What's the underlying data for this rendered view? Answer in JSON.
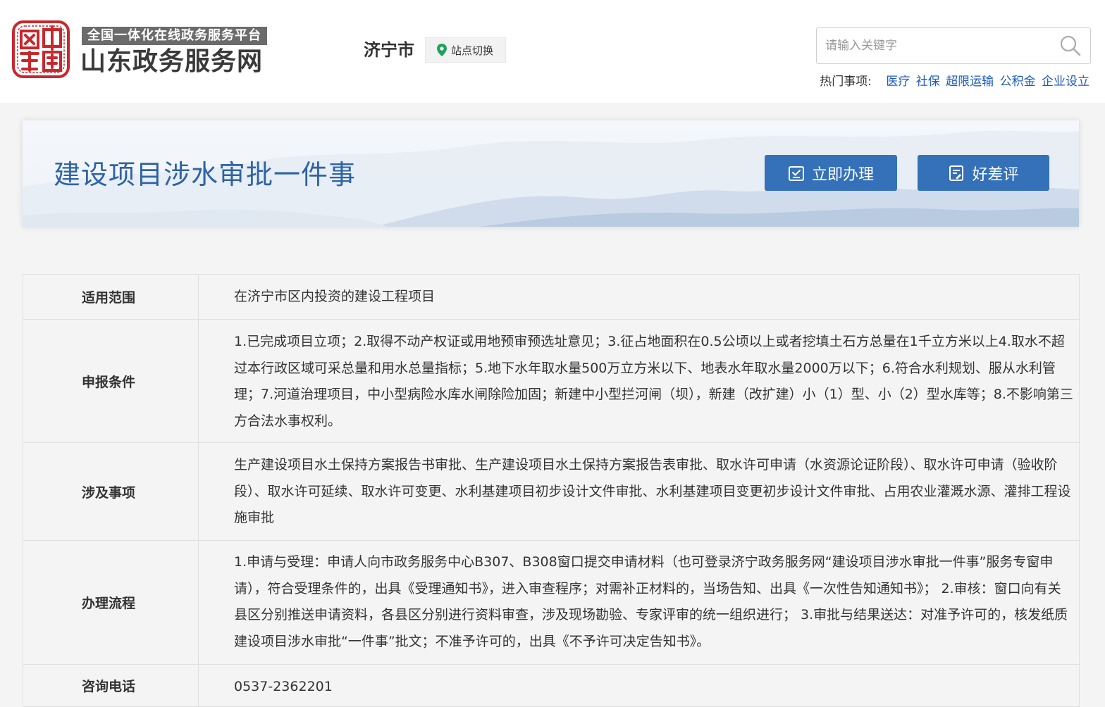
{
  "header": {
    "brand_subtitle": "全国一体化在线政务服务平台",
    "brand_title": "山东政务服务网",
    "city": "济宁市",
    "site_switch_label": "站点切换",
    "search_placeholder": "请输入关键字",
    "hot_label": "热门事项:",
    "hot_items": [
      "医疗",
      "社保",
      "超限运输",
      "公积金",
      "企业设立"
    ]
  },
  "banner": {
    "title": "建设项目涉水审批一件事",
    "apply_button": "立即办理",
    "review_button": "好差评"
  },
  "table": {
    "rows": [
      {
        "label": "适用范围",
        "value": "在济宁市区内投资的建设工程项目"
      },
      {
        "label": "申报条件",
        "value": "1.已完成项目立项；2.取得不动产权证或用地预审预选址意见；3.征占地面积在0.5公顷以上或者挖填土石方总量在1千立方米以上4.取水不超过本行政区域可采总量和用水总量指标；5.地下水年取水量500万立方米以下、地表水年取水量2000万以下；6.符合水利规划、服从水利管理；7.河道治理项目，中小型病险水库水闸除险加固；新建中小型拦河闸（坝），新建（改扩建）小（1）型、小（2）型水库等；8.不影响第三方合法水事权利。"
      },
      {
        "label": "涉及事项",
        "value": "生产建设项目水土保持方案报告书审批、生产建设项目水土保持方案报告表审批、取水许可申请（水资源论证阶段）、取水许可申请（验收阶段）、取水许可延续、取水许可变更、水利基建项目初步设计文件审批、水利基建项目变更初步设计文件审批、占用农业灌溉水源、灌排工程设施审批"
      },
      {
        "label": "办理流程",
        "value": "1.申请与受理：申请人向市政务服务中心B307、B308窗口提交申请材料（也可登录济宁政务服务网“建设项目涉水审批一件事”服务专窗申请），符合受理条件的，出具《受理通知书》，进入审查程序；对需补正材料的，当场告知、出具《一次性告知通知书》； 2.审核：窗口向有关县区分别推送申请资料，各县区分别进行资料审查，涉及现场勘验、专家评审的统一组织进行； 3.审批与结果送达：对准予许可的，核发纸质建设项目涉水审批“一件事”批文；不准予许可的，出具《不予许可决定告知书》。"
      },
      {
        "label": "咨询电话",
        "value": "0537-2362201"
      }
    ]
  },
  "colors": {
    "accent_blue": "#3471b9",
    "title_blue": "#2e63a6",
    "link_blue": "#1e5bbf",
    "seal_red": "#c8282d",
    "location_green": "#1fa35c"
  },
  "icons": {
    "seal": "china-seal-logo",
    "location": "map-pin-icon",
    "search": "magnifier-icon",
    "apply": "checklist-icon",
    "review": "document-edit-icon"
  }
}
